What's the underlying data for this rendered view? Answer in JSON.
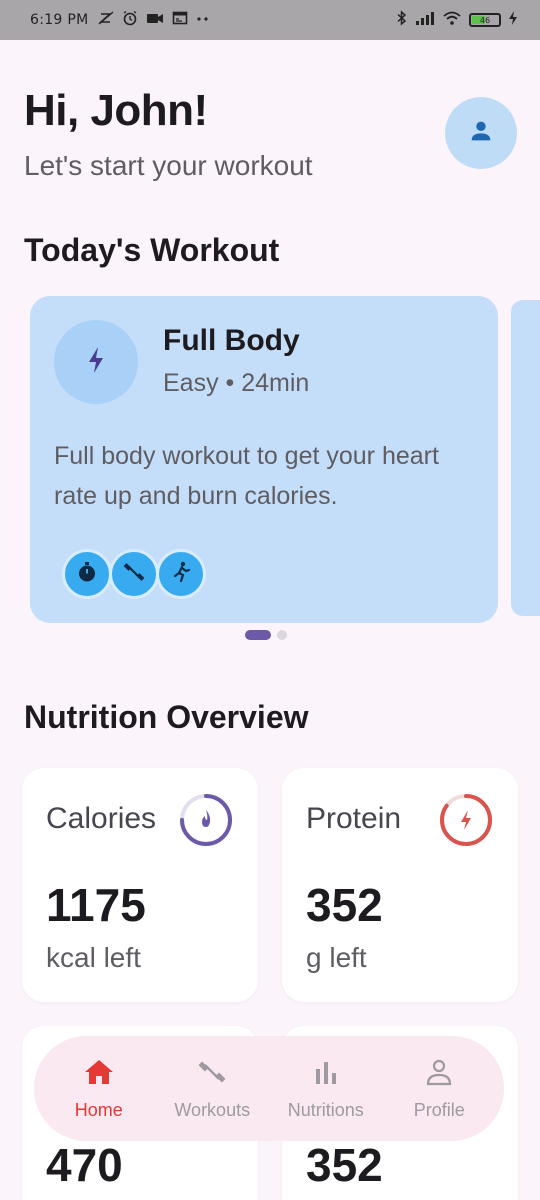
{
  "status_bar": {
    "time": "6:19 PM",
    "battery_level": "46",
    "left_icons": [
      "muted-sync-icon",
      "alarm-icon",
      "video-icon",
      "window-icon",
      "more-dots-icon"
    ],
    "right_icons": [
      "bluetooth-icon",
      "signal-icon",
      "wifi-icon",
      "battery-icon",
      "charging-icon"
    ]
  },
  "header": {
    "greeting": "Hi, John!",
    "subtitle": "Let's start your workout",
    "avatar_icon": "person-icon"
  },
  "workout_section": {
    "title": "Today's Workout",
    "card": {
      "icon": "lightning-icon",
      "name": "Full Body",
      "meta": "Easy • 24min",
      "description": "Full body workout to get your heart rate up and burn calories.",
      "equipment_icons": [
        "stopwatch-icon",
        "dumbbell-icon",
        "running-icon"
      ]
    },
    "pages": 2,
    "current_page": 1
  },
  "nutrition_section": {
    "title": "Nutrition Overview",
    "cards": [
      {
        "label": "Calories",
        "value": "1175",
        "unit": "kcal left",
        "icon": "flame-icon",
        "color": "#6c5aa8",
        "progress": 0.75
      },
      {
        "label": "Protein",
        "value": "352",
        "unit": "g left",
        "icon": "lightning-icon",
        "color": "#d9534f",
        "progress": 0.85
      },
      {
        "value": "470"
      },
      {
        "value": "352"
      }
    ]
  },
  "bottom_nav": {
    "items": [
      {
        "label": "Home",
        "icon": "home-icon",
        "active": true
      },
      {
        "label": "Workouts",
        "icon": "dumbbell-icon",
        "active": false
      },
      {
        "label": "Nutritions",
        "icon": "bar-chart-icon",
        "active": false
      },
      {
        "label": "Profile",
        "icon": "person-outline-icon",
        "active": false
      }
    ],
    "active_color": "#e53935",
    "inactive_color": "#9e9aa1"
  }
}
